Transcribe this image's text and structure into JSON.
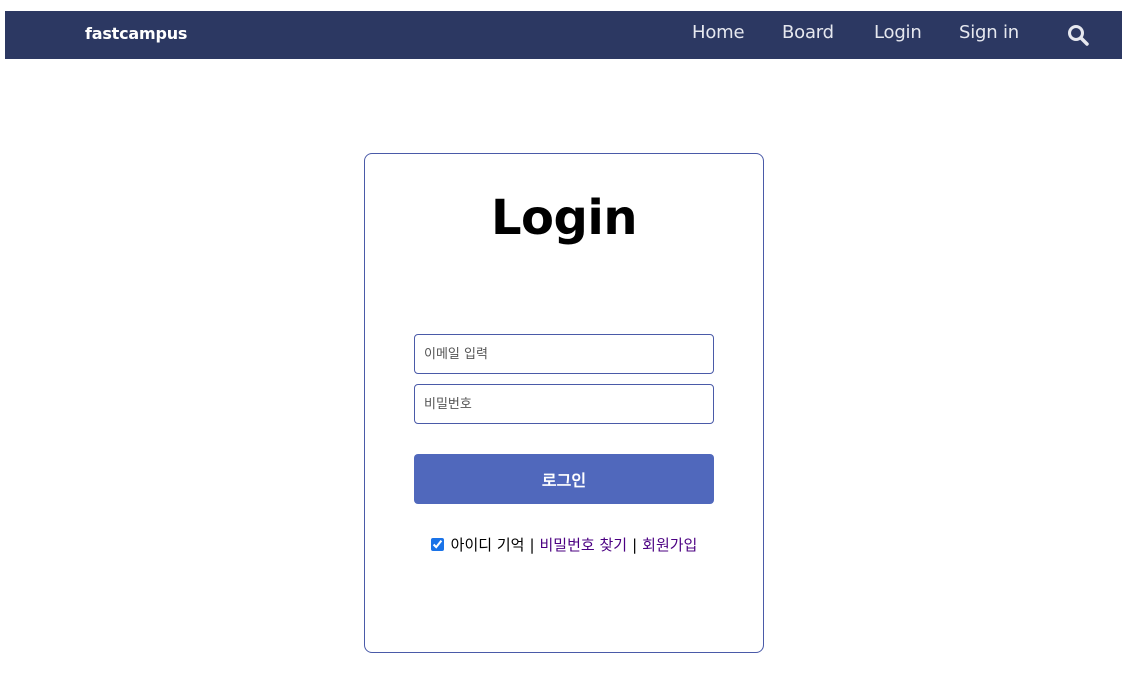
{
  "navbar": {
    "brand": "fastcampus",
    "links": [
      "Home",
      "Board",
      "Login",
      "Sign in"
    ],
    "search_icon": "search-icon",
    "bg_color": "#2c3862"
  },
  "login_card": {
    "title": "Login",
    "email_placeholder": "이메일 입력",
    "password_placeholder": "비밀번호",
    "login_button": "로그인",
    "remember_label": "아이디 기억",
    "remember_checked": true,
    "separator": "|",
    "find_password_link": "비밀번호 찾기",
    "signup_link": "회원가입",
    "accent_color": "#5068bc",
    "link_color": "#4b0082"
  }
}
